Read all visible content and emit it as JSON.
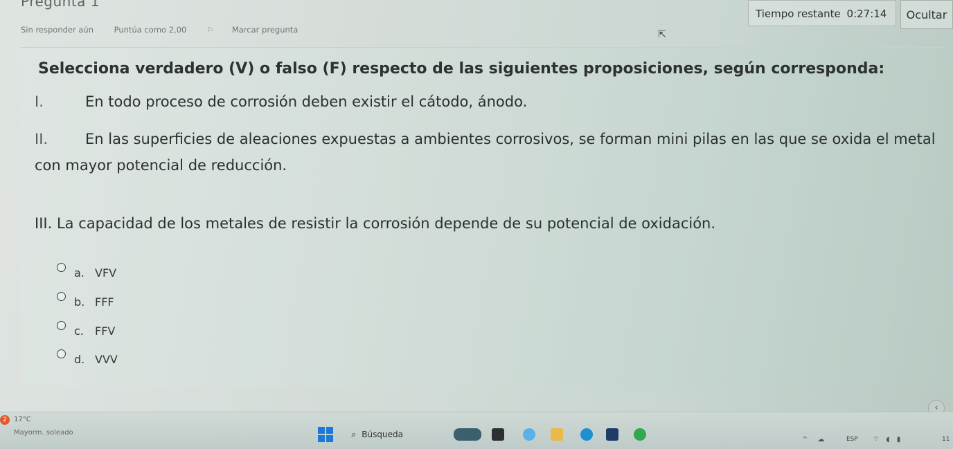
{
  "header": {
    "question_title": "Pregunta 1",
    "status": "Sin responder aún",
    "score": "Puntúa como 2,00",
    "flag_label": "Marcar pregunta",
    "timer_label": "Tiempo restante",
    "timer_value": "0:27:14",
    "hide_label": "Ocultar"
  },
  "question": {
    "prompt": "Selecciona verdadero (V) o falso (F) respecto de las siguientes proposiciones, según corresponda:",
    "propositions": [
      {
        "num": "I.",
        "text": "En todo proceso de corrosión deben existir el cátodo, ánodo."
      },
      {
        "num": "II.",
        "text": "En las superficies de aleaciones expuestas a ambientes corrosivos, se forman mini pilas en las que se oxida el metal",
        "continuation": "con mayor potencial de reducción."
      },
      {
        "num": "III.",
        "text": "La capacidad de los metales de resistir la corrosión depende de su potencial de oxidación."
      }
    ],
    "options": [
      {
        "letter": "a.",
        "text": "VFV"
      },
      {
        "letter": "b.",
        "text": "FFF"
      },
      {
        "letter": "c.",
        "text": "FFV"
      },
      {
        "letter": "d.",
        "text": "VVV"
      }
    ]
  },
  "taskbar": {
    "weather_badge": "2",
    "weather_temp": "17°C",
    "weather_desc": "Mayorm. soleado",
    "search_label": "Búsqueda",
    "lang": "ESP",
    "time": "11"
  },
  "icons": [
    "flag-icon",
    "cursor-icon",
    "radio-icon",
    "chevron-left-icon",
    "windows-start-icon",
    "search-icon",
    "wifi-icon",
    "volume-icon",
    "battery-icon"
  ]
}
